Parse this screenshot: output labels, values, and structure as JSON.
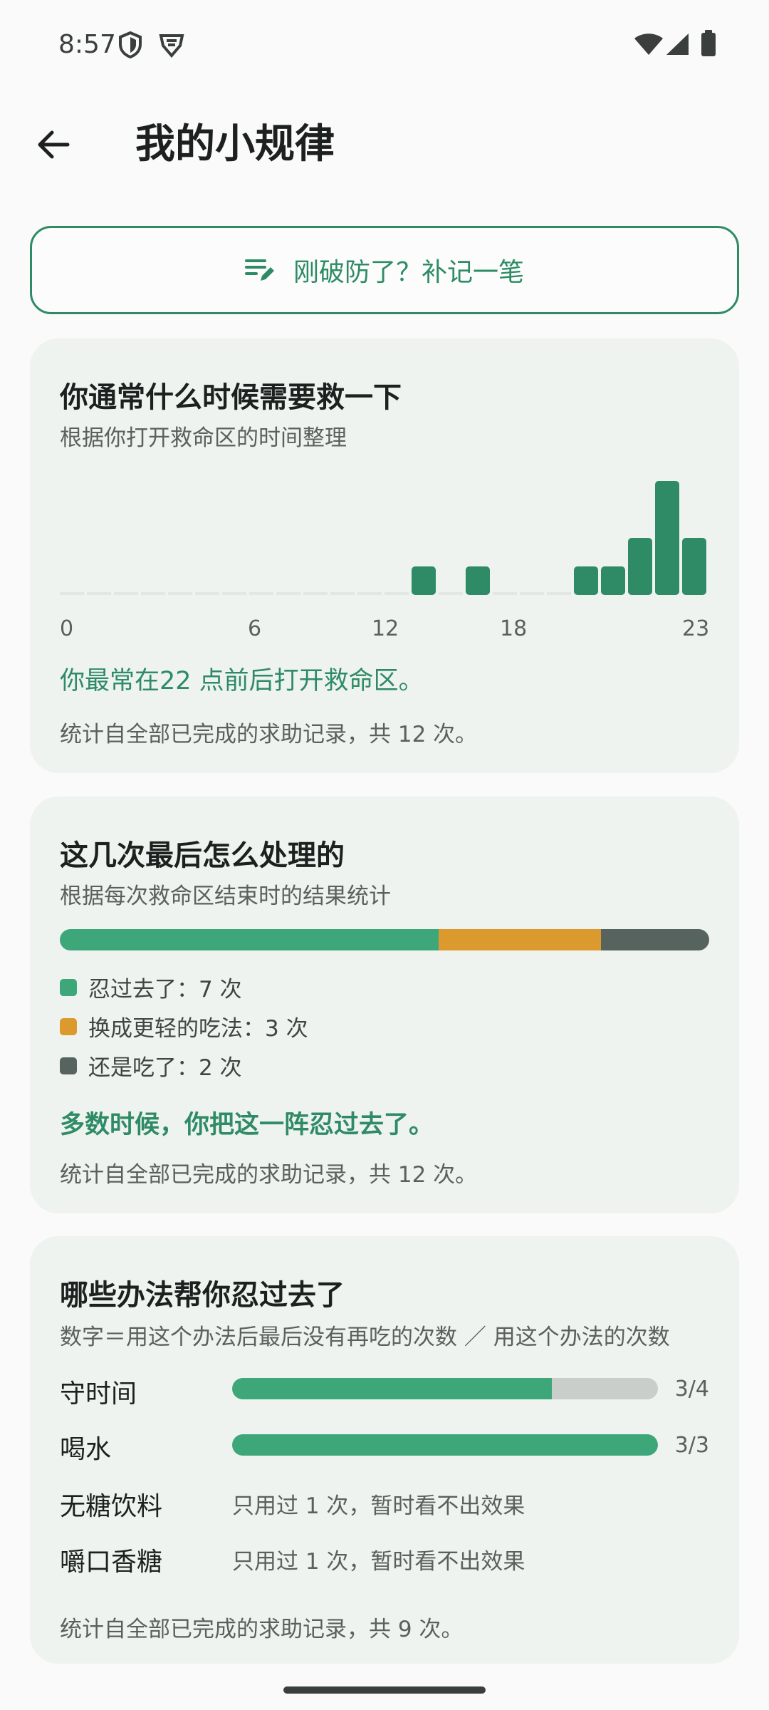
{
  "status_bar": {
    "time": "8:57",
    "icons": [
      "shield-icon",
      "vpn-badge-icon",
      "wifi-icon",
      "signal-icon",
      "battery-icon"
    ]
  },
  "app_bar": {
    "back_icon": "arrow-back-icon",
    "title": "我的小规律"
  },
  "backfill_button": {
    "icon": "edit-note-icon",
    "label": "刚破防了？补记一笔"
  },
  "time_card": {
    "title": "你通常什么时候需要救一下",
    "subtitle": "根据你打开救命区的时间整理",
    "insight": "你最常在22 点前后打开救命区。",
    "footnote": "统计自全部已完成的求助记录，共 12 次。",
    "chart_data": {
      "type": "bar",
      "categories": [
        "0",
        "1",
        "2",
        "3",
        "4",
        "5",
        "6",
        "7",
        "8",
        "9",
        "10",
        "11",
        "12",
        "13",
        "14",
        "15",
        "16",
        "17",
        "18",
        "19",
        "20",
        "21",
        "22",
        "23"
      ],
      "values": [
        0,
        0,
        0,
        0,
        0,
        0,
        0,
        0,
        0,
        0,
        0,
        0,
        0,
        1,
        0,
        1,
        0,
        0,
        0,
        1,
        1,
        2,
        4,
        2
      ],
      "tick_labels": [
        "0",
        "6",
        "12",
        "18",
        "23"
      ],
      "bar_color": "#2e8b65",
      "empty_color": "#e2e7e4"
    }
  },
  "outcome_card": {
    "title": "这几次最后怎么处理的",
    "subtitle": "根据每次救命区结束时的结果统计",
    "segments": [
      {
        "label": "忍过去了：7 次",
        "value": 7,
        "color": "#3da77a"
      },
      {
        "label": "换成更轻的吃法：3 次",
        "value": 3,
        "color": "#dc9a2e"
      },
      {
        "label": "还是吃了：2 次",
        "value": 2,
        "color": "#57635e"
      }
    ],
    "insight": "多数时候，你把这一阵忍过去了。",
    "footnote": "统计自全部已完成的求助记录，共 12 次。"
  },
  "methods_card": {
    "title": "哪些办法帮你忍过去了",
    "subtitle": "数字＝用这个办法后最后没有再吃的次数 ／ 用这个办法的次数",
    "methods": [
      {
        "name": "守时间",
        "success": 3,
        "total": 4,
        "ratio": "3/4"
      },
      {
        "name": "喝水",
        "success": 3,
        "total": 3,
        "ratio": "3/3"
      },
      {
        "name": "无糖饮料",
        "note": "只用过 1 次，暂时看不出效果"
      },
      {
        "name": "嚼口香糖",
        "note": "只用过 1 次，暂时看不出效果"
      }
    ],
    "footnote": "统计自全部已完成的求助记录，共 9 次。"
  }
}
